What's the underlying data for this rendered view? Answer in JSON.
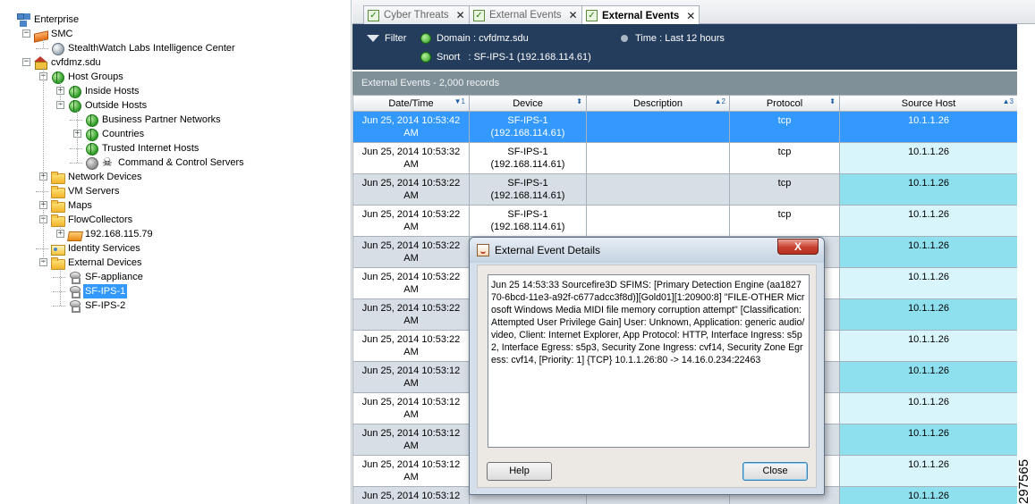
{
  "tree": [
    {
      "id": "enterprise",
      "label": "Enterprise",
      "icon": "network-icon",
      "level": 0,
      "expander": ""
    },
    {
      "id": "smc",
      "label": "SMC",
      "icon": "smc-icon",
      "level": 1,
      "expander": "-"
    },
    {
      "id": "stealthwatch-labs",
      "label": "StealthWatch Labs Intelligence Center",
      "icon": "server-icon",
      "level": 2,
      "expander": ""
    },
    {
      "id": "cvfdmz",
      "label": "cvfdmz.sdu",
      "icon": "domain-icon",
      "level": 1,
      "expander": "-"
    },
    {
      "id": "host-groups",
      "label": "Host Groups",
      "icon": "host-groups-icon",
      "level": 2,
      "expander": "-"
    },
    {
      "id": "inside-hosts",
      "label": "Inside Hosts",
      "icon": "globe-icon",
      "level": 3,
      "expander": "+"
    },
    {
      "id": "outside-hosts",
      "label": "Outside Hosts",
      "icon": "globe-icon",
      "level": 3,
      "expander": "-"
    },
    {
      "id": "business-partner",
      "label": "Business Partner Networks",
      "icon": "globe-icon",
      "level": 4,
      "expander": ""
    },
    {
      "id": "countries",
      "label": "Countries",
      "icon": "globe-icon",
      "level": 4,
      "expander": "+"
    },
    {
      "id": "trusted-internet",
      "label": "Trusted Internet Hosts",
      "icon": "globe-icon",
      "level": 4,
      "expander": ""
    },
    {
      "id": "command-control",
      "label": "Command & Control Servers",
      "icon": "skull-icon",
      "level": 4,
      "expander": ""
    },
    {
      "id": "network-devices",
      "label": "Network Devices",
      "icon": "folder-icon",
      "level": 2,
      "expander": "+"
    },
    {
      "id": "vm-servers",
      "label": "VM Servers",
      "icon": "folder-icon",
      "level": 2,
      "expander": ""
    },
    {
      "id": "maps",
      "label": "Maps",
      "icon": "folder-icon",
      "level": 2,
      "expander": "+"
    },
    {
      "id": "flowcollectors",
      "label": "FlowCollectors",
      "icon": "folder-icon",
      "level": 2,
      "expander": "-"
    },
    {
      "id": "fc-ip",
      "label": "192.168.115.79",
      "icon": "flowcollector-icon",
      "level": 3,
      "expander": "+"
    },
    {
      "id": "identity-services",
      "label": "Identity Services",
      "icon": "identity-icon",
      "level": 2,
      "expander": ""
    },
    {
      "id": "external-devices",
      "label": "External Devices",
      "icon": "folder-icon",
      "level": 2,
      "expander": "-"
    },
    {
      "id": "sf-appliance",
      "label": "SF-appliance",
      "icon": "sensor-icon",
      "level": 3,
      "expander": ""
    },
    {
      "id": "sf-ips-1",
      "label": "SF-IPS-1",
      "icon": "sensor-icon",
      "level": 3,
      "expander": "",
      "selected": true
    },
    {
      "id": "sf-ips-2",
      "label": "SF-IPS-2",
      "icon": "sensor-icon",
      "level": 3,
      "expander": ""
    }
  ],
  "tabs": [
    {
      "label": "Cyber Threats",
      "active": false
    },
    {
      "label": "External Events",
      "active": false
    },
    {
      "label": "External Events",
      "active": true
    }
  ],
  "filters": {
    "filter_label": "Filter",
    "domain": "Domain : cvfdmz.sdu",
    "snort": "Snort   : SF-IPS-1 (192.168.114.61)",
    "time": "Time : Last 12 hours"
  },
  "records_label": "External Events - 2,000 records",
  "columns": [
    {
      "label": "Date/Time",
      "sort": "▼1"
    },
    {
      "label": "Device",
      "sort": "⬍"
    },
    {
      "label": "Description",
      "sort": "▲2"
    },
    {
      "label": "Protocol",
      "sort": "⬍"
    },
    {
      "label": "Source Host",
      "sort": "▲3"
    }
  ],
  "rows": [
    {
      "datetime": "Jun 25, 2014 10:53:42 AM",
      "device": "SF-IPS-1 (192.168.114.61)",
      "description": "",
      "protocol": "tcp",
      "source": "10.1.1.26",
      "selected": true
    },
    {
      "datetime": "Jun 25, 2014 10:53:32 AM",
      "device": "SF-IPS-1 (192.168.114.61)",
      "description": "",
      "protocol": "tcp",
      "source": "10.1.1.26"
    },
    {
      "datetime": "Jun 25, 2014 10:53:22 AM",
      "device": "SF-IPS-1 (192.168.114.61)",
      "description": "",
      "protocol": "tcp",
      "source": "10.1.1.26"
    },
    {
      "datetime": "Jun 25, 2014 10:53:22 AM",
      "device": "SF-IPS-1 (192.168.114.61)",
      "description": "",
      "protocol": "tcp",
      "source": "10.1.1.26"
    },
    {
      "datetime": "Jun 25, 2014 10:53:22 AM",
      "device": "",
      "description": "",
      "protocol": "",
      "source": "10.1.1.26"
    },
    {
      "datetime": "Jun 25, 2014 10:53:22 AM",
      "device": "",
      "description": "",
      "protocol": "",
      "source": "10.1.1.26"
    },
    {
      "datetime": "Jun 25, 2014 10:53:22 AM",
      "device": "",
      "description": "",
      "protocol": "",
      "source": "10.1.1.26"
    },
    {
      "datetime": "Jun 25, 2014 10:53:22 AM",
      "device": "",
      "description": "",
      "protocol": "",
      "source": "10.1.1.26"
    },
    {
      "datetime": "Jun 25, 2014 10:53:12 AM",
      "device": "",
      "description": "",
      "protocol": "",
      "source": "10.1.1.26"
    },
    {
      "datetime": "Jun 25, 2014 10:53:12 AM",
      "device": "",
      "description": "",
      "protocol": "",
      "source": "10.1.1.26"
    },
    {
      "datetime": "Jun 25, 2014 10:53:12 AM",
      "device": "",
      "description": "",
      "protocol": "",
      "source": "10.1.1.26"
    },
    {
      "datetime": "Jun 25, 2014 10:53:12 AM",
      "device": "",
      "description": "",
      "protocol": "",
      "source": "10.1.1.26"
    },
    {
      "datetime": "Jun 25, 2014 10:53:12",
      "device": "",
      "description": "",
      "protocol": "",
      "source": "10.1.1.26"
    }
  ],
  "dialog": {
    "title": "External Event Details",
    "close_glyph": "X",
    "text": "Jun 25 14:53:33 Sourcefire3D SFIMS: [Primary Detection Engine (aa182770-6bcd-11e3-a92f-c677adcc3f8d)][Gold01][1:20900:8] \"FILE-OTHER Microsoft Windows Media MIDI file memory corruption attempt\" [Classification: Attempted User Privilege Gain] User: Unknown, Application: generic audio/video, Client: Internet Explorer, App Protocol: HTTP, Interface Ingress: s5p2, Interface Egress: s5p3, Security Zone Ingress: cvf14, Security Zone Egress: cvf14, [Priority: 1] {TCP} 10.1.1.26:80 -> 14.16.0.234:22463",
    "help_label": "Help",
    "close_label": "Close"
  },
  "figure_id": "297565",
  "colors": {
    "filter_bar": "#243d5c",
    "records_bar": "#7f9099",
    "selection": "#3399ff",
    "source_col": "#8fe0ee"
  }
}
